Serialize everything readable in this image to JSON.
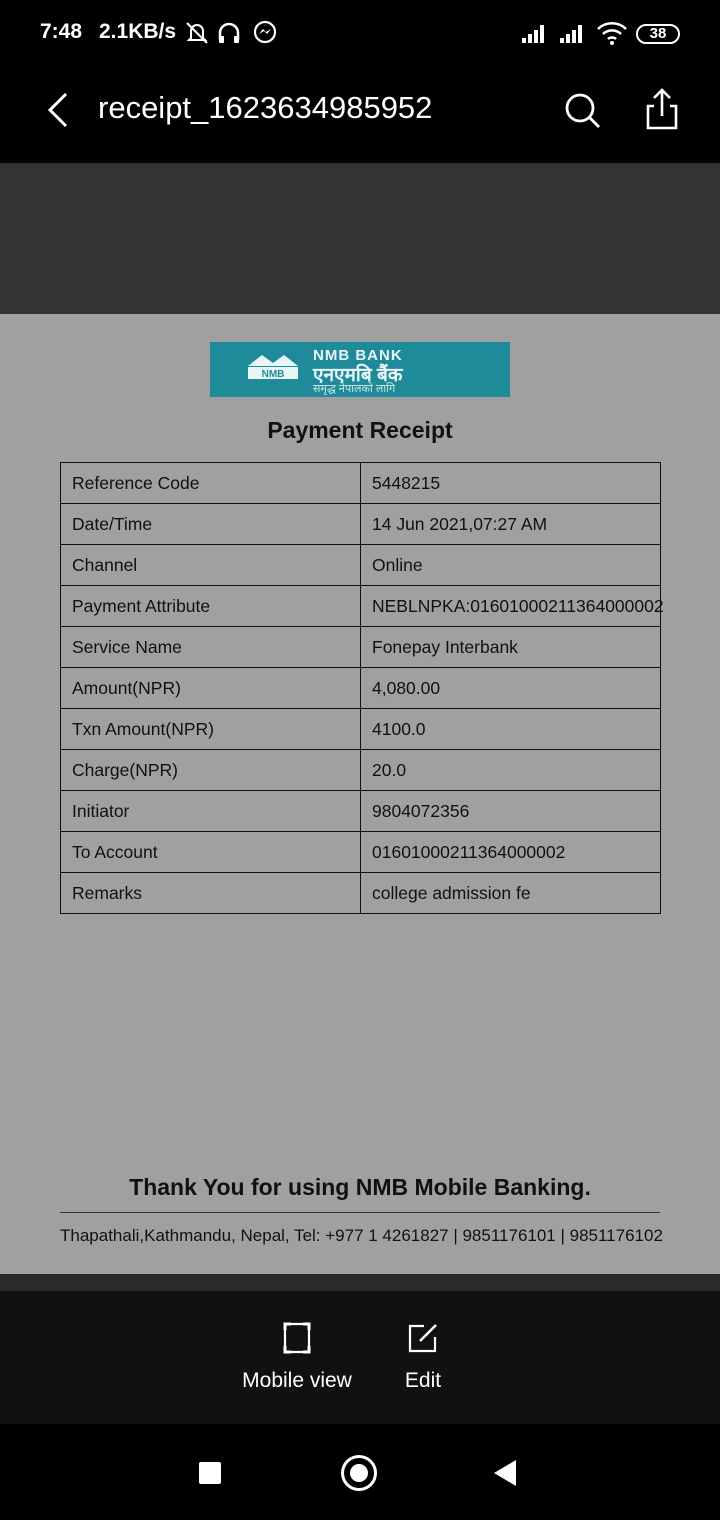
{
  "status_bar": {
    "time": "7:48",
    "net_speed": "2.1KB/s",
    "battery": "38",
    "icons": [
      "mute-icon",
      "headphones-icon",
      "messenger-icon",
      "signal-icon",
      "signal-icon",
      "wifi-icon",
      "battery-icon"
    ]
  },
  "app_bar": {
    "title": "receipt_1623634985952",
    "icons": [
      "back-arrow-icon",
      "search-icon",
      "share-icon"
    ]
  },
  "document": {
    "logo": {
      "english": "NMB BANK",
      "nepali": "एनएमबि बैंक",
      "tagline": "समृद्ध नेपालको लागि",
      "mark": "NMB"
    },
    "heading": "Payment Receipt",
    "rows": [
      {
        "label": "Reference Code",
        "value": "5448215"
      },
      {
        "label": "Date/Time",
        "value": "14 Jun 2021,07:27 AM"
      },
      {
        "label": "Channel",
        "value": "Online"
      },
      {
        "label": "Payment Attribute",
        "value": "NEBLNPKA:01601000211364000002"
      },
      {
        "label": "Service Name",
        "value": "Fonepay Interbank"
      },
      {
        "label": "Amount(NPR)",
        "value": "4,080.00"
      },
      {
        "label": "Txn Amount(NPR)",
        "value": "4100.0"
      },
      {
        "label": "Charge(NPR)",
        "value": "20.0"
      },
      {
        "label": "Initiator",
        "value": "9804072356"
      },
      {
        "label": "To Account",
        "value": "01601000211364000002"
      },
      {
        "label": "Remarks",
        "value": "college admission fe"
      }
    ],
    "thanks": "Thank You for using NMB Mobile Banking.",
    "address": "Thapathali,Kathmandu, Nepal, Tel: +977 1  4261827 | 9851176101 | 9851176102"
  },
  "toolbar": {
    "mobile_view_label": "Mobile view",
    "edit_label": "Edit"
  },
  "colors": {
    "page_bg": "#a0a0a0",
    "logo_bg": "#1f8a9a",
    "band": "#333333"
  }
}
